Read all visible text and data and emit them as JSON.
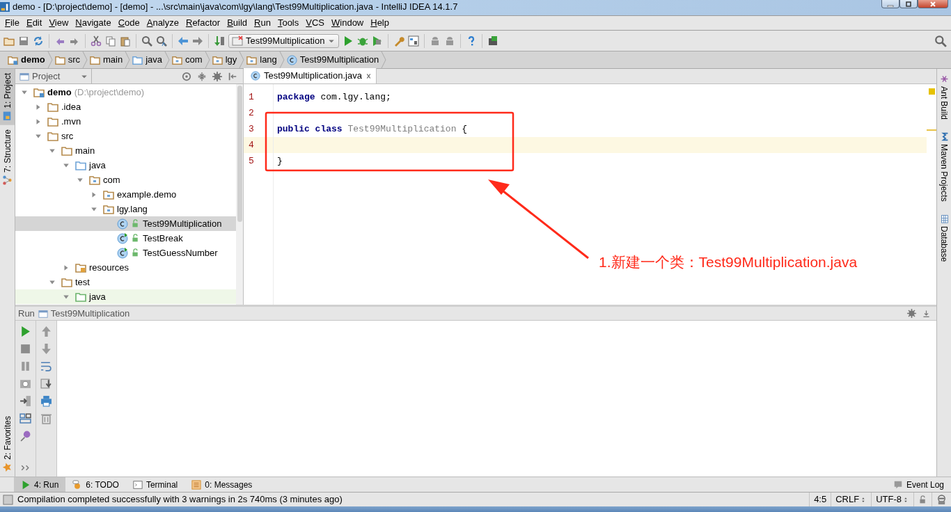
{
  "window": {
    "title": "demo - [D:\\project\\demo] - [demo] - ...\\src\\main\\java\\com\\lgy\\lang\\Test99Multiplication.java - IntelliJ IDEA 14.1.7"
  },
  "menu": [
    "File",
    "Edit",
    "View",
    "Navigate",
    "Code",
    "Analyze",
    "Refactor",
    "Build",
    "Run",
    "Tools",
    "VCS",
    "Window",
    "Help"
  ],
  "toolbar": {
    "run_config": "Test99Multiplication"
  },
  "breadcrumbs": [
    {
      "label": "demo",
      "kind": "module"
    },
    {
      "label": "src",
      "kind": "folder"
    },
    {
      "label": "main",
      "kind": "folder"
    },
    {
      "label": "java",
      "kind": "source_root"
    },
    {
      "label": "com",
      "kind": "package"
    },
    {
      "label": "lgy",
      "kind": "package"
    },
    {
      "label": "lang",
      "kind": "package"
    },
    {
      "label": "Test99Multiplication",
      "kind": "class"
    }
  ],
  "left_tabs": [
    {
      "label": "1: Project",
      "selected": true
    },
    {
      "label": "7: Structure",
      "selected": false
    }
  ],
  "left_bottom_tab": {
    "label": "2: Favorites"
  },
  "project_panel": {
    "view": "Project",
    "tree": [
      {
        "label": "demo",
        "hint": "(D:\\project\\demo)",
        "kind": "module",
        "expanded": true,
        "selected": false,
        "children": [
          {
            "label": ".idea",
            "kind": "folder",
            "expanded": false,
            "selected": false
          },
          {
            "label": ".mvn",
            "kind": "folder",
            "expanded": false,
            "selected": false
          },
          {
            "label": "src",
            "kind": "folder",
            "expanded": true,
            "selected": false,
            "children": [
              {
                "label": "main",
                "kind": "folder",
                "expanded": true,
                "selected": false,
                "children": [
                  {
                    "label": "java",
                    "kind": "source_root",
                    "expanded": true,
                    "selected": false,
                    "children": [
                      {
                        "label": "com",
                        "kind": "package",
                        "expanded": true,
                        "selected": false,
                        "children": [
                          {
                            "label": "example.demo",
                            "kind": "package",
                            "expanded": false,
                            "selected": false
                          },
                          {
                            "label": "lgy.lang",
                            "kind": "package",
                            "expanded": true,
                            "selected": false,
                            "children": [
                              {
                                "label": "Test99Multiplication",
                                "kind": "class",
                                "selected": true
                              },
                              {
                                "label": "TestBreak",
                                "kind": "runnable_class",
                                "selected": false
                              },
                              {
                                "label": "TestGuessNumber",
                                "kind": "runnable_class",
                                "selected": false
                              }
                            ]
                          }
                        ]
                      }
                    ]
                  },
                  {
                    "label": "resources",
                    "kind": "resources",
                    "expanded": false,
                    "selected": false
                  }
                ]
              },
              {
                "label": "test",
                "kind": "folder",
                "expanded": true,
                "selected": false,
                "children": [
                  {
                    "label": "java",
                    "kind": "test_root",
                    "expanded": true,
                    "selected": false
                  }
                ]
              }
            ]
          }
        ]
      }
    ]
  },
  "editor": {
    "tab": "Test99Multiplication.java",
    "lines": [
      {
        "number": "1",
        "current": false,
        "tokens": [
          {
            "text": "package",
            "kind": "keyword"
          },
          {
            "text": " com.lgy.lang;",
            "kind": "plain"
          }
        ]
      },
      {
        "number": "2",
        "current": false
      },
      {
        "number": "3",
        "current": false,
        "tokens": [
          {
            "text": "public class",
            "kind": "keyword"
          },
          {
            "text": " Test99Multiplication",
            "kind": "unused"
          },
          {
            "text": " {",
            "kind": "plain"
          }
        ]
      },
      {
        "number": "4",
        "current": true
      },
      {
        "number": "5",
        "current": false,
        "tokens": [
          {
            "text": "}",
            "kind": "plain"
          }
        ]
      }
    ]
  },
  "annotation": {
    "text": "1.新建一个类：Test99Multiplication.java"
  },
  "right_tabs": [
    "Ant Build",
    "Maven Projects",
    "Database"
  ],
  "run_panel": {
    "label": "Run",
    "config": "Test99Multiplication"
  },
  "bottom_tabs": [
    {
      "label": "4: Run",
      "selected": true
    },
    {
      "label": "6: TODO",
      "selected": false
    },
    {
      "label": "Terminal",
      "selected": false
    },
    {
      "label": "0: Messages",
      "selected": false
    }
  ],
  "event_log": "Event Log",
  "status_bar": {
    "message": "Compilation completed successfully with 3 warnings in 2s 740ms (3 minutes ago)",
    "position": "4:5",
    "line_separator": "CRLF",
    "encoding": "UTF-8"
  }
}
